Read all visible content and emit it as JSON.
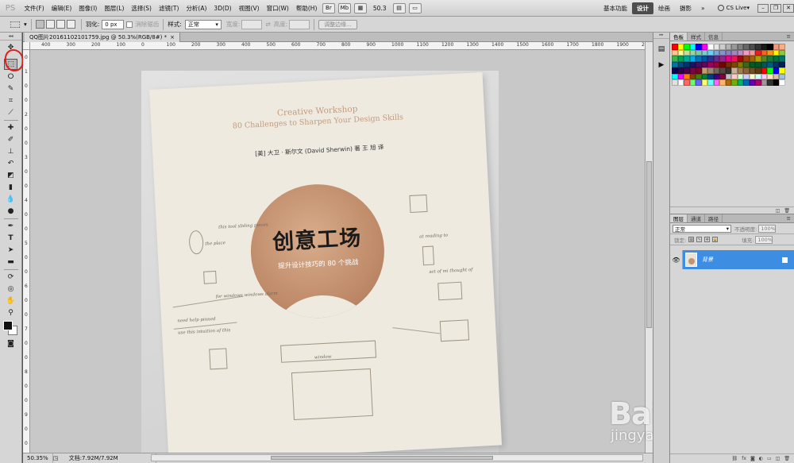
{
  "app": {
    "logo": "PS"
  },
  "menu": [
    "文件(F)",
    "编辑(E)",
    "图像(I)",
    "图层(L)",
    "选择(S)",
    "滤镜(T)",
    "分析(A)",
    "3D(D)",
    "视图(V)",
    "窗口(W)",
    "帮助(H)"
  ],
  "menubar": {
    "zoom": "50.3",
    "workspaces": [
      "基本功能",
      "设计",
      "绘画",
      "摄影"
    ],
    "active_workspace": "设计",
    "cslive": "CS Live"
  },
  "options": {
    "feather_label": "羽化:",
    "feather_value": "0 px",
    "antialias_label": "消除锯齿",
    "style_label": "样式:",
    "style_value": "正常",
    "width_label": "宽度:",
    "height_label": "高度:",
    "refine_edge": "调整边缘..."
  },
  "document": {
    "tab_title": "QQ图片20161102101759.jpg @ 50.3%(RGB/8#) *",
    "close": "×",
    "ruler_h": [
      "400",
      "300",
      "200",
      "100",
      "0",
      "100",
      "200",
      "300",
      "400",
      "500",
      "600",
      "700",
      "800",
      "900",
      "1000",
      "1100",
      "1200",
      "1300",
      "1400",
      "1500",
      "1600",
      "1700",
      "1800",
      "1900",
      "2000"
    ],
    "ruler_v": [
      "0",
      "1",
      "0",
      "0",
      "2",
      "0",
      "0",
      "3",
      "0",
      "0",
      "4",
      "0",
      "0",
      "5",
      "0",
      "0",
      "6",
      "0",
      "0",
      "7",
      "0",
      "0",
      "8",
      "0",
      "0",
      "9",
      "0",
      "0"
    ]
  },
  "cover": {
    "en_line1": "Creative Workshop",
    "en_line2": "80 Challenges to Sharpen Your Design Skills",
    "author": "[美] 大卫 · 斯尔文 (David Sherwin) 著      王 旭 译",
    "cn_title": "创意工场",
    "cn_subtitle": "提升设计技巧的 80 个挑战",
    "sketch_notes": [
      "this tool sliding pieces",
      "the place",
      "for windows windows alarm",
      "need help pinned",
      "use this intuition of this",
      "at reading to",
      "set of mi thought of",
      "window"
    ]
  },
  "status": {
    "zoom": "50.35%",
    "doc_info": "文档:7.92M/7.92M"
  },
  "panels": {
    "swatches_tabs": [
      "色板",
      "样式",
      "信息"
    ],
    "layers_tabs": [
      "图层",
      "通道",
      "路径"
    ],
    "blend_mode": "正常",
    "opacity_label": "不透明度:",
    "opacity_value": "100%",
    "lock_label": "锁定:",
    "fill_label": "填充:",
    "fill_value": "100%",
    "layer_name": "背景"
  },
  "watermark": {
    "logo": "Bai du 经验",
    "url": "jingyan.baidu.com"
  },
  "colors": {
    "accent": "#3d8ee3",
    "annotation": "#e01d1d",
    "swatches": [
      "#ff0000",
      "#ffff00",
      "#00ff00",
      "#00ffff",
      "#0000ff",
      "#ff00ff",
      "#ffffff",
      "#e6e6e6",
      "#cccccc",
      "#b3b3b3",
      "#999999",
      "#808080",
      "#666666",
      "#4d4d4d",
      "#333333",
      "#1a1a1a",
      "#000000",
      "#f7977a",
      "#f9ad81",
      "#fdc68a",
      "#fff79a",
      "#c4df9b",
      "#a3d39c",
      "#82ca9d",
      "#7bcdc8",
      "#6ecff6",
      "#7ea7d8",
      "#8493ca",
      "#8882be",
      "#a187be",
      "#bc8dbf",
      "#f49ac2",
      "#f6989d",
      "#ed1c24",
      "#f26522",
      "#f7941d",
      "#fff200",
      "#8dc73f",
      "#39b54a",
      "#00a651",
      "#00a99d",
      "#00aeef",
      "#0072bc",
      "#0054a6",
      "#2e3192",
      "#662d91",
      "#92278f",
      "#ec008c",
      "#ed145b",
      "#9e0b0f",
      "#a0410d",
      "#a36209",
      "#aba000",
      "#598527",
      "#1a7b30",
      "#007236",
      "#00746b",
      "#0076a3",
      "#004b80",
      "#003471",
      "#1b1464",
      "#440e62",
      "#630460",
      "#9e005d",
      "#9e0039",
      "#790000",
      "#7b2e00",
      "#7d4900",
      "#827b00",
      "#406618",
      "#005e20",
      "#005826",
      "#005952",
      "#005b7f",
      "#003663",
      "#002157",
      "#0d004c",
      "#32004b",
      "#4b0049",
      "#7b0046",
      "#7a0026",
      "#c69c6d",
      "#998675",
      "#736357",
      "#534741",
      "#37302d",
      "#c7b299",
      "#a67c52",
      "#8c6239",
      "#754c24",
      "#603913",
      "#ff0000",
      "#00ff00",
      "#0000ff",
      "#ffff00",
      "#00ffff",
      "#ff00ff",
      "#ff8000",
      "#804000",
      "#408000",
      "#008040",
      "#004080",
      "#400080",
      "#800040",
      "#c0c0c0",
      "#ffcccc",
      "#ccffcc",
      "#ccccff",
      "#ffffcc",
      "#ccffff",
      "#ffccff",
      "#ffe0c0",
      "#e0c0a0",
      "#a0c0e0",
      "#e0e0e0",
      "#ffffff",
      "#ff6666",
      "#66ff66",
      "#6666ff",
      "#ffff66",
      "#66ffff",
      "#ff66ff",
      "#ffb366",
      "#b36b00",
      "#6bb300",
      "#00b36b",
      "#006bb3",
      "#6b00b3",
      "#b3006b",
      "#999999",
      "#333333",
      "#000000",
      "#ffffff"
    ]
  }
}
